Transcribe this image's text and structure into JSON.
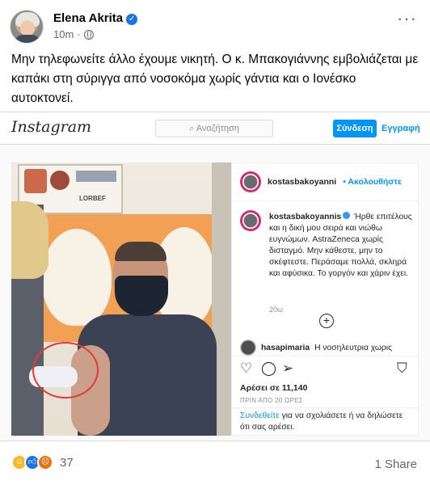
{
  "post": {
    "author": "Elena Akrita",
    "time": "10m",
    "text": "Μην τηλεφωνείτε άλλο έχουμε νικητή. Ο κ. Μπακογιάννης εμβολιάζεται με καπάκι στη σύριγγα από νοσοκόμα χωρίς γάντια και ο Ιονέσκο αυτοκτονεί."
  },
  "instagram": {
    "logo": "Instagram",
    "search_placeholder": "Αναζήτηση",
    "login_label": "Σύνδεση",
    "signup_label": "Εγγραφή",
    "header_user": "kostasbakoyanni",
    "follow_label": "Ακολουθήστε",
    "caption_user": "kostasbakoyannis",
    "caption_text": "Ήρθε επιτέλους και η δική μου σειρά και νιώθω ευγνώμων. AstraZeneca χωρίς δισταγμό. Μην κάθεστε, μην το σκέφτεστε. Περάσαμε πολλά, σκληρά και αφύσικα. Το γοργόν και χάριν έχει.",
    "caption_time": "20ω",
    "comment_user": "hasapimaria",
    "comment_text": "Η νοσηλευτρια χωρις",
    "likes": "Αρέσει σε 11,140",
    "posted_ago": "ΠΡΙΝ ΑΠΟ 20 ΩΡΕΣ",
    "login_link": "Συνδεθείτε",
    "login_note": " για να σχολιάσετε ή να δηλώσετε ότι σας αρέσει.",
    "photo_label": "LORBEF"
  },
  "reactions": {
    "count": "37",
    "shares": "1 Share"
  },
  "colors": {
    "facebook_blue": "#1b74e4",
    "instagram_blue": "#0095f6",
    "annotation_red": "#e23a3a"
  },
  "icons": [
    "more-icon",
    "globe-icon",
    "verified-icon",
    "search-icon",
    "heart-icon",
    "comment-icon",
    "share-icon",
    "bookmark-icon",
    "plus-circle-icon"
  ]
}
